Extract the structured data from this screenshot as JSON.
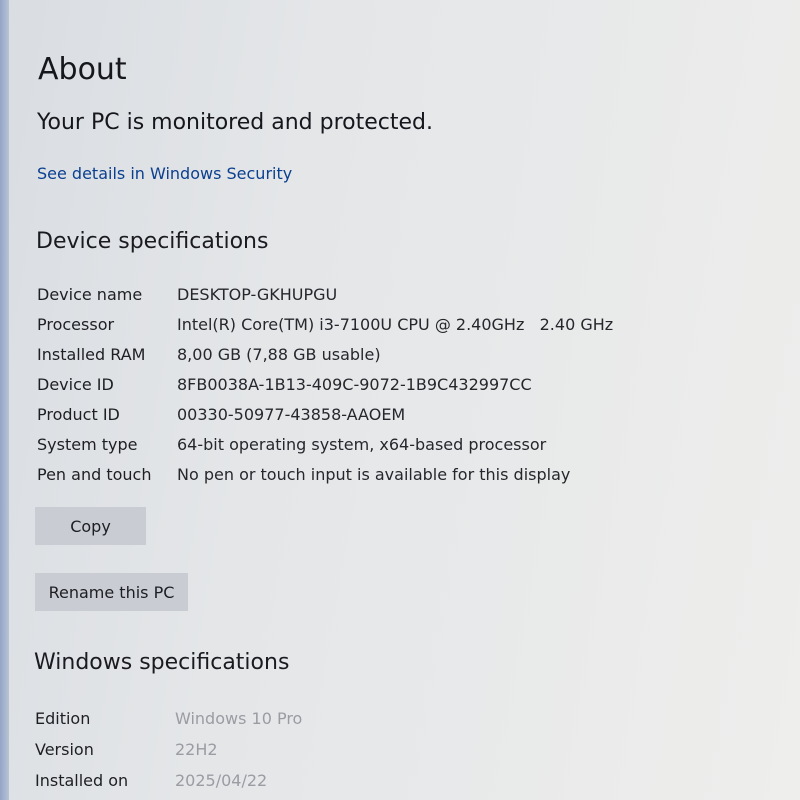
{
  "page": {
    "title": "About",
    "protection_status": "Your PC is monitored and protected.",
    "security_link": "See details in Windows Security"
  },
  "device_specs": {
    "heading": "Device specifications",
    "rows": [
      {
        "label": "Device name",
        "value": "DESKTOP-GKHUPGU"
      },
      {
        "label": "Processor",
        "value": "Intel(R) Core(TM) i3-7100U CPU @ 2.40GHz   2.40 GHz"
      },
      {
        "label": "Installed RAM",
        "value": "8,00 GB (7,88 GB usable)"
      },
      {
        "label": "Device ID",
        "value": "8FB0038A-1B13-409C-9072-1B9C432997CC"
      },
      {
        "label": "Product ID",
        "value": "00330-50977-43858-AAOEM"
      },
      {
        "label": "System type",
        "value": "64-bit operating system, x64-based processor"
      },
      {
        "label": "Pen and touch",
        "value": "No pen or touch input is available for this display"
      }
    ],
    "copy_label": "Copy",
    "rename_label": "Rename this PC"
  },
  "windows_specs": {
    "heading": "Windows specifications",
    "rows": [
      {
        "label": "Edition",
        "value": "Windows 10 Pro"
      },
      {
        "label": "Version",
        "value": "22H2"
      },
      {
        "label": "Installed on",
        "value": "2025/04/22"
      }
    ]
  }
}
